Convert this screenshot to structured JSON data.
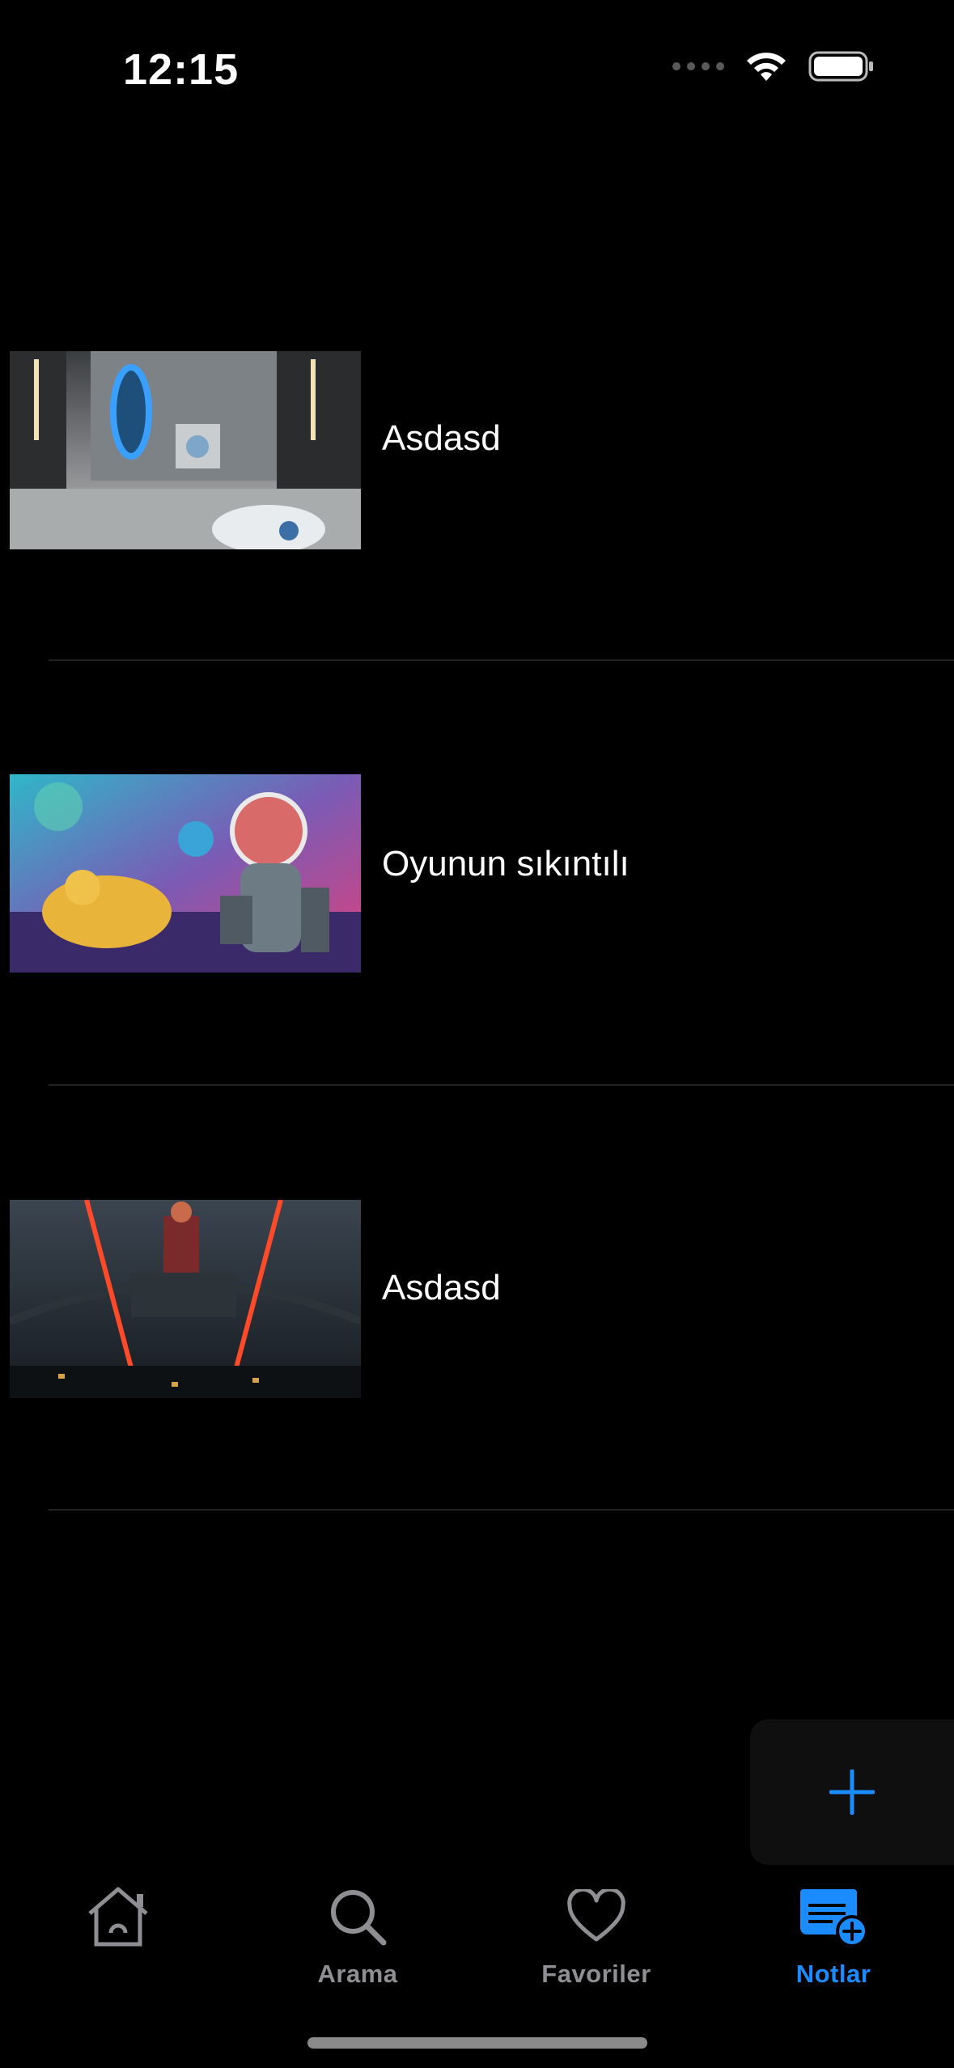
{
  "status_bar": {
    "time": "12:15"
  },
  "notes": [
    {
      "title": "Asdasd",
      "thumbnail": "portal-game-screenshot"
    },
    {
      "title": "Oyunun sıkıntılı",
      "thumbnail": "astronaut-game-art"
    },
    {
      "title": "Asdasd",
      "thumbnail": "ferris-wheel-game-art"
    }
  ],
  "fab": {
    "icon": "plus-icon",
    "color": "#1a8cff"
  },
  "tabbar": {
    "tabs": [
      {
        "label": "",
        "icon": "home-icon"
      },
      {
        "label": "Arama",
        "icon": "search-icon"
      },
      {
        "label": "Favoriler",
        "icon": "heart-icon"
      },
      {
        "label": "Notlar",
        "icon": "notes-add-icon",
        "active": true
      }
    ],
    "active_color": "#1a8cff",
    "inactive_color": "#8e8e93"
  }
}
